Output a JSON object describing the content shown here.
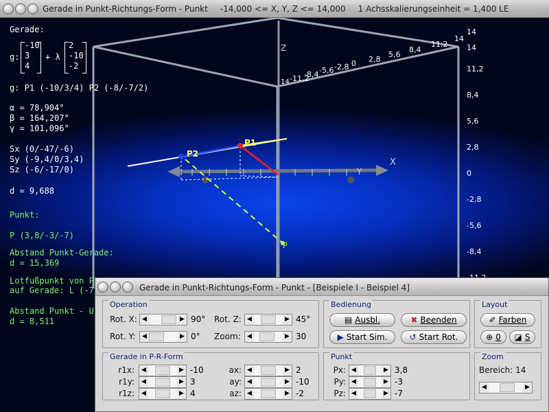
{
  "main_window": {
    "title": "Gerade in Punkt-Richtungs-Form - Punkt",
    "range_info": "-14,000 <= X, Y, Z <= 14,000",
    "scale_info": "1 Achsskalierungseinheit = 1,400 LE"
  },
  "info": {
    "gerade_heading": "Gerade:",
    "g_prefix": "g:",
    "support_vector": [
      "-10",
      "3",
      "4"
    ],
    "lambda_op": "+ λ",
    "direction_vector": [
      "2",
      "-10",
      "-2"
    ],
    "points_line": "g: P1 (-10/3/4)   P2 (-8/-7/2)",
    "alpha": "α = 78,904°",
    "beta": "β = 164,207°",
    "gamma": "γ = 101,096°",
    "sx": "Sx (0/-47/-6)",
    "sy": "Sy (-9,4/0/3,4)",
    "sz": "Sz (-6/-17/0)",
    "d": "d = 9,688",
    "punkt_heading": "Punkt:",
    "punkt_p": "P (3,8/-3/-7)",
    "abstand_pg_label": "Abstand Punkt-Gerade:",
    "abstand_pg_value": "d = 15,369",
    "lotfuss_line1": "Lotfußpunkt von P",
    "lotfuss_line2": "auf Gerade: L (-7,",
    "abstand_pu_label": "Abstand Punkt - U",
    "abstand_pu_value": "d = 8,511"
  },
  "scene": {
    "axis_z_label": "Z",
    "axis_x_label": "X",
    "axis_y_label": "Y",
    "right_ticks": [
      "14",
      "11,2",
      "8,4",
      "5,6",
      "2,8",
      "0",
      "-2,8",
      "-5,6",
      "-8,4",
      "-11,2"
    ],
    "top_ticks": [
      "-11,2",
      "-8,4",
      "-5,6",
      "-2,8",
      "0",
      "2,8",
      "5,6",
      "8,4",
      "11,2",
      "14"
    ],
    "top_corner_tick": "14",
    "z_tick": "14",
    "point_labels": {
      "p1": "P1",
      "p2": "P2",
      "p": "P"
    }
  },
  "dialog": {
    "title": "Gerade in Punkt-Richtungs-Form - Punkt - [Beispiele I - Beispiel 4]",
    "operation": {
      "label": "Operation",
      "rot_x_label": "Rot. X:",
      "rot_x_value": "90°",
      "rot_y_label": "Rot. Y:",
      "rot_y_value": "0°",
      "rot_z_label": "Rot. Z:",
      "rot_z_value": "45°",
      "zoom_label": "Zoom:",
      "zoom_value": "30"
    },
    "bedienung": {
      "label": "Bedienung",
      "ausbl": "Ausbl.",
      "beenden": "Beenden",
      "start_sim": "Start Sim.",
      "start_rot": "Start Rot."
    },
    "layout": {
      "label": "Layout",
      "farben": "Farben",
      "zero_btn": "0",
      "s_btn": "S"
    },
    "gerade_form": {
      "label": "Gerade in P-R-Form",
      "rows": [
        {
          "a": "r1x:",
          "av": "-10",
          "b": "ax:",
          "bv": "2"
        },
        {
          "a": "r1y:",
          "av": "3",
          "b": "ay:",
          "bv": "-10"
        },
        {
          "a": "r1z:",
          "av": "4",
          "b": "az:",
          "bv": "-2"
        }
      ]
    },
    "punkt": {
      "label": "Punkt",
      "px_label": "Px:",
      "px_value": "3,8",
      "py_label": "Py:",
      "py_value": "-3",
      "pz_label": "Pz:",
      "pz_value": "-7"
    },
    "zoom": {
      "label": "Zoom",
      "bereich": "Bereich:  14"
    }
  }
}
